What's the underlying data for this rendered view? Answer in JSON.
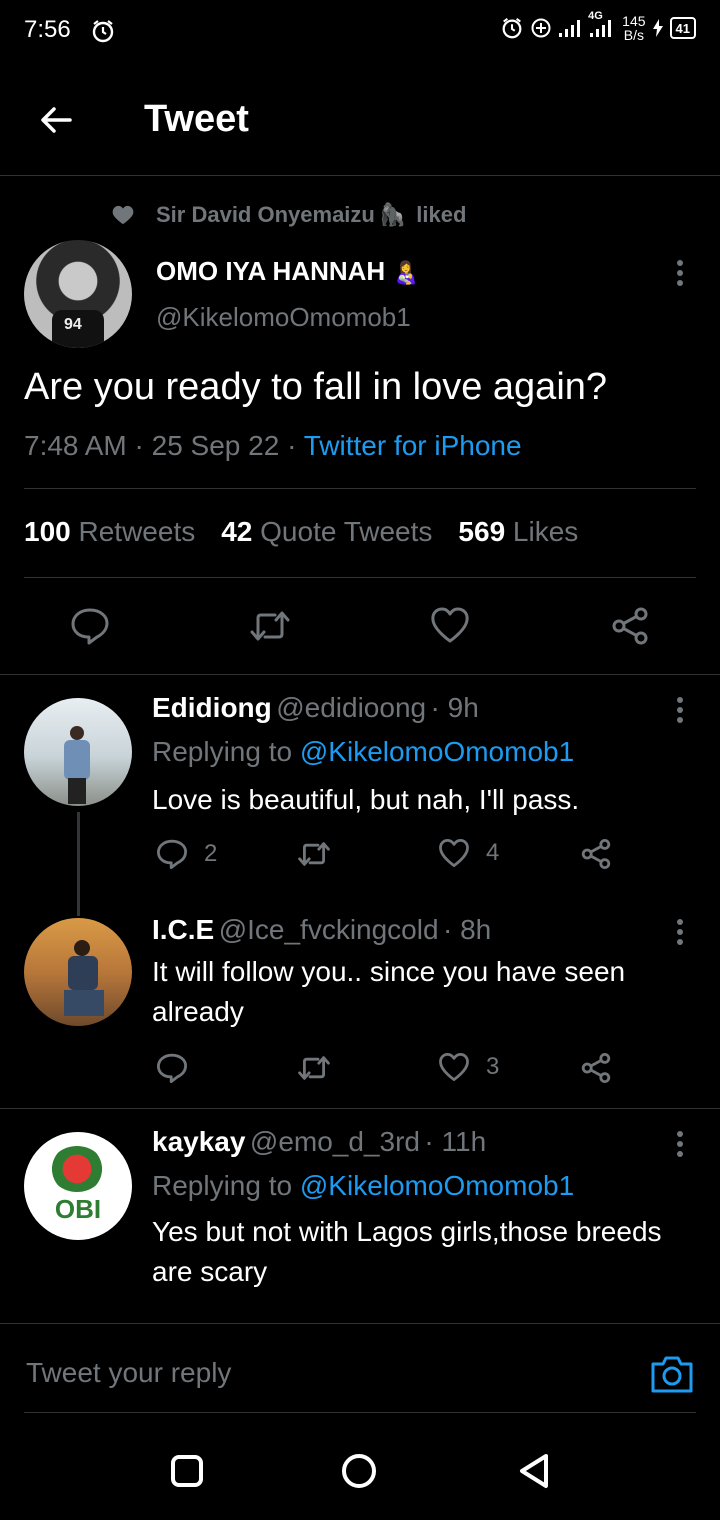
{
  "status": {
    "time": "7:56",
    "net_type": "4G",
    "speed": "145",
    "speed_unit": "B/s",
    "battery": "41"
  },
  "header": {
    "back_icon": "arrow-left-icon",
    "title": "Tweet"
  },
  "social_context": {
    "text": "Sir David Onyemaizu",
    "emoji": "🦍",
    "suffix": "liked"
  },
  "tweet": {
    "author_name": "OMO IYA HANNAH",
    "author_emoji": "👩‍🍼",
    "author_handle": "@KikelomoOmomob1",
    "text": "Are you ready to fall in love again?",
    "time": "7:48 AM",
    "date": "25 Sep 22",
    "separator": "·",
    "source": "Twitter for iPhone",
    "stats": {
      "retweets_count": "100",
      "retweets_label": "Retweets",
      "quotes_count": "42",
      "quotes_label": "Quote Tweets",
      "likes_count": "569",
      "likes_label": "Likes"
    }
  },
  "replies": [
    {
      "name": "Edidiong",
      "handle": "@edidioong",
      "time": "· 9h",
      "replying_label": "Replying to",
      "replying_to": "@KikelomoOmomob1",
      "text": "Love is beautiful, but nah, I'll pass.",
      "reply_count": "2",
      "like_count": "4"
    },
    {
      "name": "I.C.E",
      "handle": "@Ice_fvckingcold",
      "time": "· 8h",
      "text": "It will follow you.. since you have seen already",
      "reply_count": "",
      "like_count": "3"
    },
    {
      "name": "kaykay",
      "handle": "@emo_d_3rd",
      "time": "· 11h",
      "replying_label": "Replying to",
      "replying_to": "@KikelomoOmomob1",
      "text": "Yes but not with Lagos girls,those breeds are scary",
      "avatar_text": "OBI"
    }
  ],
  "reply_bar": {
    "placeholder": "Tweet your reply"
  },
  "colors": {
    "background": "#000000",
    "accent": "#1d9bf0",
    "muted": "#71767b",
    "divider": "#2f3336"
  }
}
